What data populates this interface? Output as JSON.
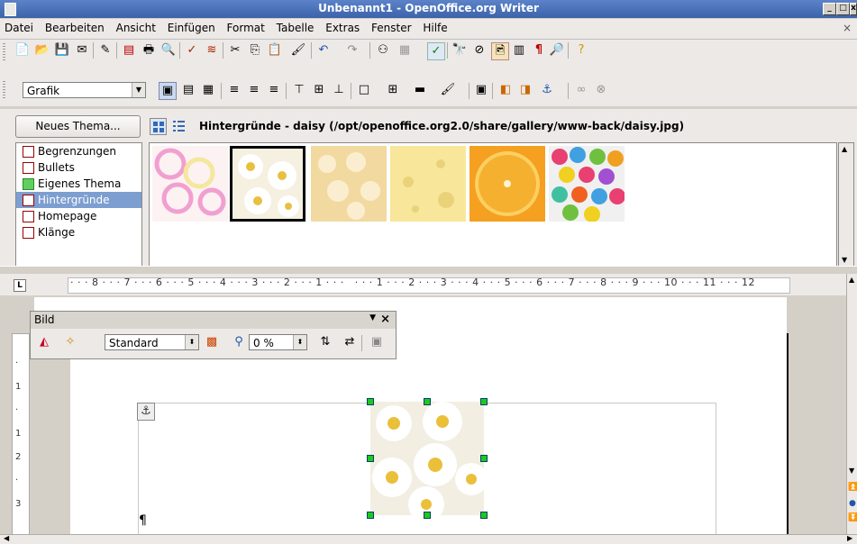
{
  "window": {
    "title": "Unbenannt1 - OpenOffice.org Writer"
  },
  "menu": [
    "Datei",
    "Bearbeiten",
    "Ansicht",
    "Einfügen",
    "Format",
    "Tabelle",
    "Extras",
    "Fenster",
    "Hilfe"
  ],
  "format_toolbar": {
    "frame_style": "Grafik"
  },
  "gallery": {
    "new_theme_label": "Neues Thema...",
    "path": "Hintergründe - daisy (/opt/openoffice.org2.0/share/gallery/www-back/daisy.jpg)",
    "themes": [
      "Begrenzungen",
      "Bullets",
      "Eigenes Thema",
      "Hintergründe",
      "Homepage",
      "Klänge"
    ],
    "selected_theme": "Hintergründe",
    "thumbnails": [
      "circles",
      "daisy",
      "popcorn",
      "cheese",
      "orange",
      "confetti"
    ],
    "selected_thumbnail": "daisy"
  },
  "ruler": {
    "text": "· · · 8 · · · 7 · · · 6 · · · 5 · · · 4 · · · 3 · · · 2 · · · 1 · · ·   · · · 1 · · · 2 · · · 3 · · · 4 · · · 5 · · · 6 · · · 7 · · · 8 · · · 9 · · · 10 · · · 11 · · · 12"
  },
  "image_toolbar": {
    "title": "Bild",
    "graphics_mode": "Standard",
    "transparency": "0 %"
  },
  "document": {
    "paragraph_mark": "¶"
  },
  "colors": {
    "selection": "#7d9ed0",
    "handle": "#1ec81e"
  }
}
